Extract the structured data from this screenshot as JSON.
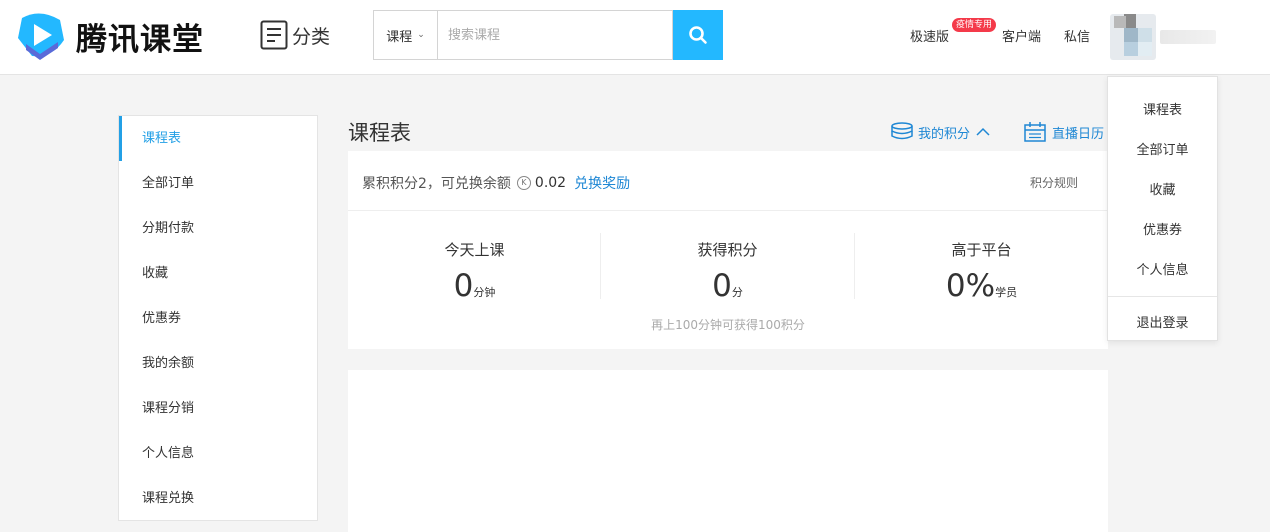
{
  "header": {
    "logo_text": "腾讯课堂",
    "category_label": "分类",
    "search": {
      "type_selected": "课程",
      "placeholder": "搜索课程"
    },
    "nav": {
      "lite": "极速版",
      "lite_badge": "疫情专用",
      "client": "客户端",
      "messages": "私信"
    }
  },
  "sidebar": {
    "items": [
      {
        "label": "课程表",
        "active": true
      },
      {
        "label": "全部订单"
      },
      {
        "label": "分期付款"
      },
      {
        "label": "收藏"
      },
      {
        "label": "优惠券"
      },
      {
        "label": "我的余额"
      },
      {
        "label": "课程分销"
      },
      {
        "label": "个人信息"
      },
      {
        "label": "课程兑换"
      }
    ]
  },
  "main": {
    "title": "课程表",
    "points_link": "我的积分",
    "live_calendar_link": "直播日历",
    "summary_prefix": "累积积分2，可兑换余额",
    "balance": "0.02",
    "redeem_link": "兑换奖励",
    "rules_link": "积分规则",
    "stats": [
      {
        "label": "今天上课",
        "value": "0",
        "unit": "分钟"
      },
      {
        "label": "获得积分",
        "value": "0",
        "unit": "分"
      },
      {
        "label": "高于平台",
        "value": "0%",
        "unit": "学员"
      }
    ],
    "hint": "再上100分钟可获得100积分"
  },
  "user_menu": {
    "items": [
      "课程表",
      "全部订单",
      "收藏",
      "优惠券",
      "个人信息"
    ],
    "logout": "退出登录"
  },
  "colors": {
    "accent": "#23a0e6",
    "search_button": "#23b8ff",
    "badge": "#f43a4a"
  }
}
